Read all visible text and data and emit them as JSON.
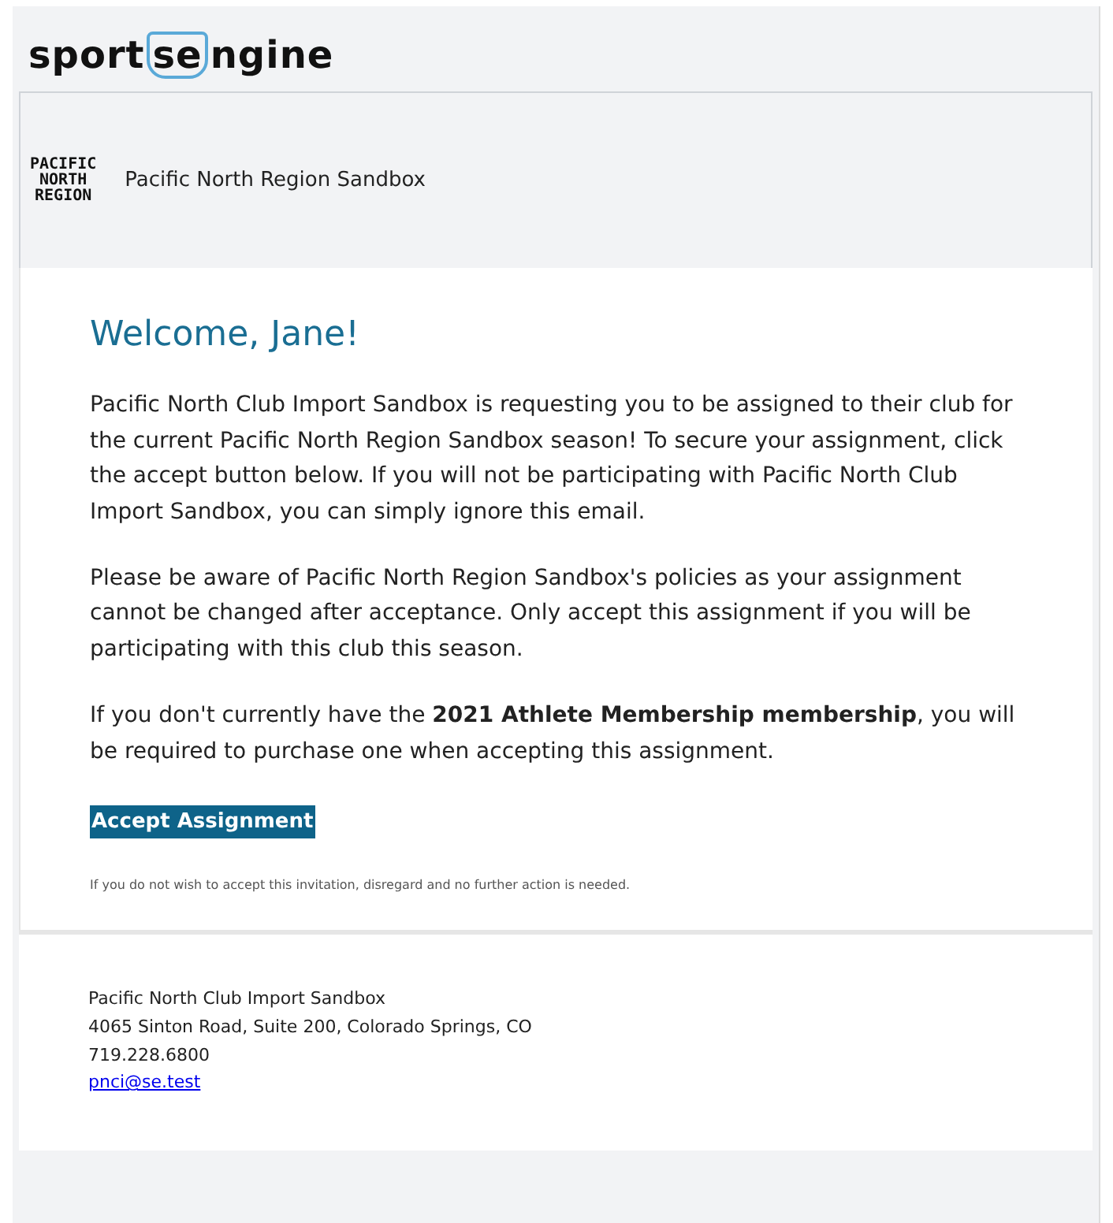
{
  "brand": {
    "logo_parts": [
      "sport",
      "se",
      "ngine"
    ]
  },
  "org": {
    "logo_lines": [
      "PACIFIC",
      "NORTH",
      "REGION"
    ],
    "name": "Pacific North Region Sandbox"
  },
  "message": {
    "heading": "Welcome, Jane!",
    "paragraphs": [
      "Pacific North Club Import Sandbox is requesting you to be assigned to their club for the current Pacific North Region Sandbox season! To secure your assignment, click the accept button below. If you will not be participating with Pacific North Club Import Sandbox, you can simply ignore this email.",
      "Please be aware of Pacific North Region Sandbox's policies as your assignment cannot be changed after acceptance. Only accept this assignment if you will be participating with this club this season.",
      "If you don't currently have the **2021 Athlete Membership membership**, you will be required to purchase one when accepting this assignment."
    ],
    "button": "Accept Assignment",
    "note": "If you do not wish to accept this invitation, disregard and no further action is needed."
  },
  "footer": {
    "lines": [
      "Pacific North Club Import Sandbox",
      "4065 Sinton Road, Suite 200, Colorado Springs, CO",
      "719.228.6800"
    ],
    "email": "pnci@se.test"
  }
}
